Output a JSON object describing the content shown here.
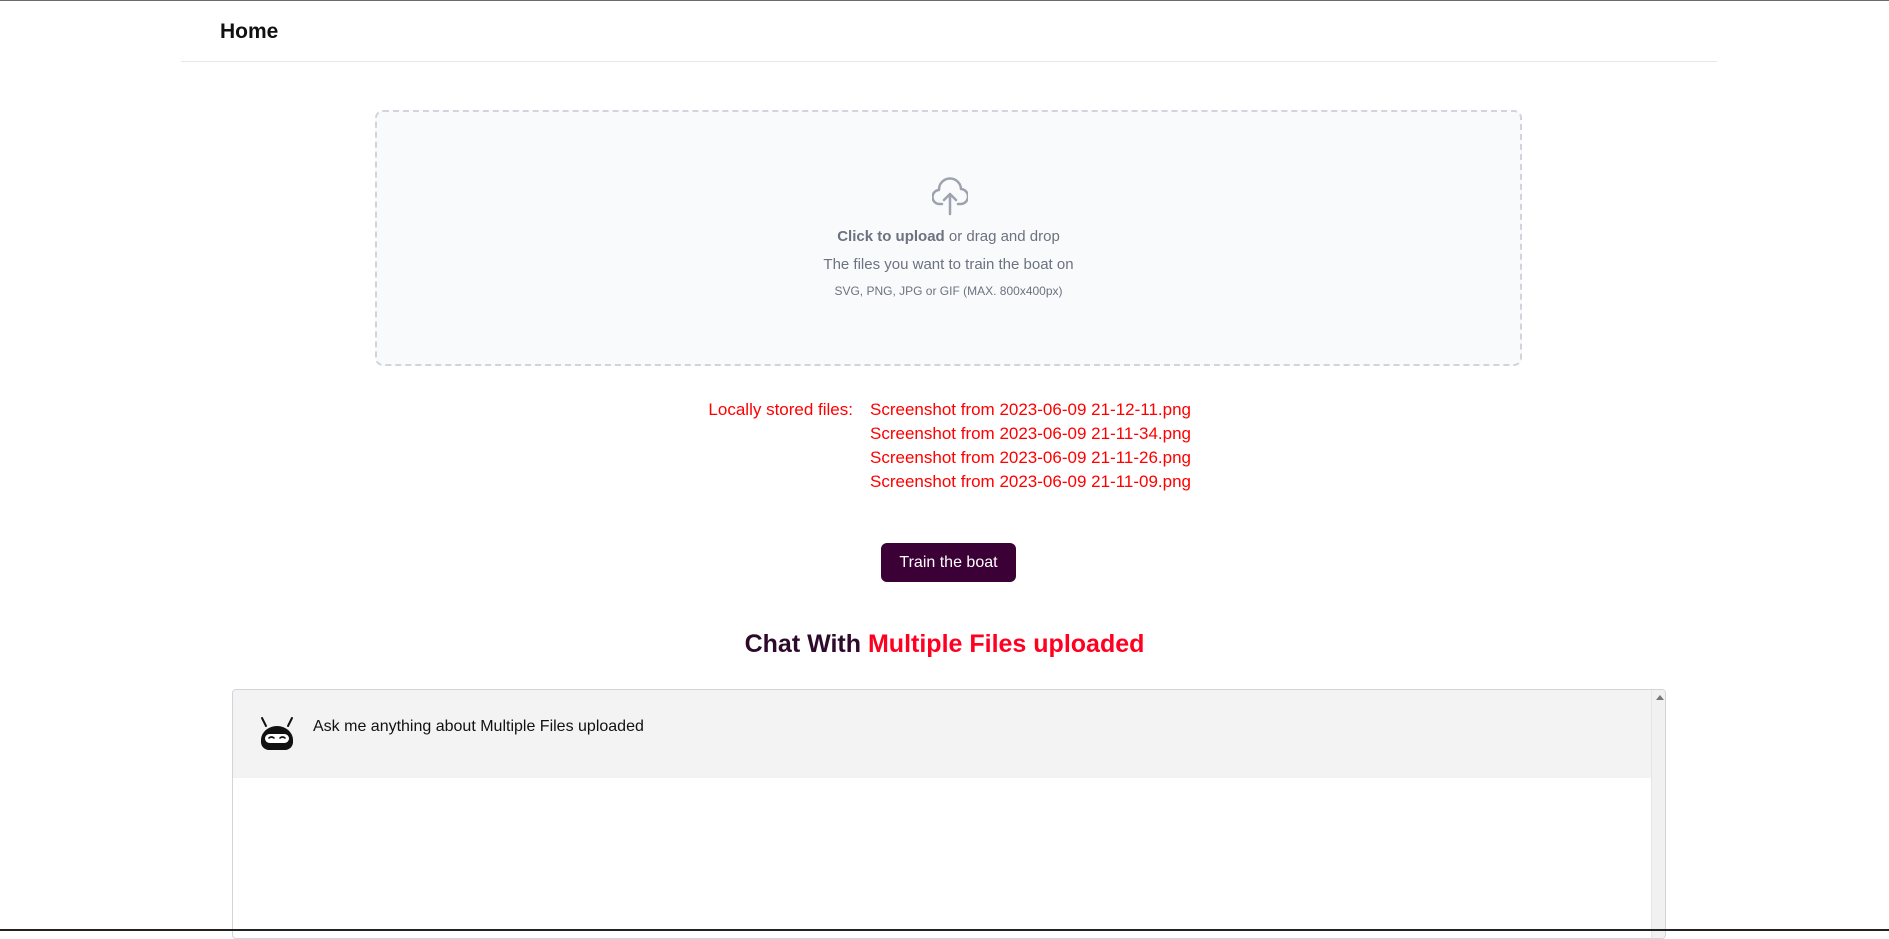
{
  "nav": {
    "title": "Home"
  },
  "upload": {
    "icon": "cloud-upload-icon",
    "click_text": "Click to upload",
    "drag_text": " or drag and drop",
    "description": "The files you want to train the boat on",
    "formats": "SVG, PNG, JPG or GIF (MAX. 800x400px)"
  },
  "files": {
    "label": "Locally stored files:",
    "items": [
      "Screenshot from 2023-06-09 21-12-11.png",
      "Screenshot from 2023-06-09 21-11-34.png",
      "Screenshot from 2023-06-09 21-11-26.png",
      "Screenshot from 2023-06-09 21-11-09.png"
    ]
  },
  "train_button": {
    "label": "Train the boat",
    "color": "#3b0035"
  },
  "chat": {
    "title_part1": "Chat With ",
    "title_part2": "Multiple Files uploaded",
    "title_color1": "#2d0a2b",
    "title_color2": "#ff0021",
    "greeting": "Ask me anything about Multiple Files uploaded",
    "avatar_icon": "robot-avatar-icon"
  }
}
